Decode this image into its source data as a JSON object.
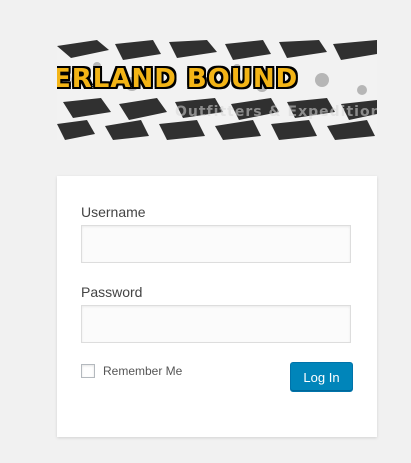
{
  "banner": {
    "title": "ERLAND BOUND",
    "subtitle": "Outfitters & Expeditions"
  },
  "form": {
    "username_label": "Username",
    "username_value": "",
    "password_label": "Password",
    "password_value": "",
    "remember_label": "Remember Me",
    "remember_checked": false,
    "submit_label": "Log In"
  },
  "colors": {
    "primary_button": "#0085ba",
    "banner_text": "#f3b416",
    "page_background": "#f1f1f1"
  }
}
